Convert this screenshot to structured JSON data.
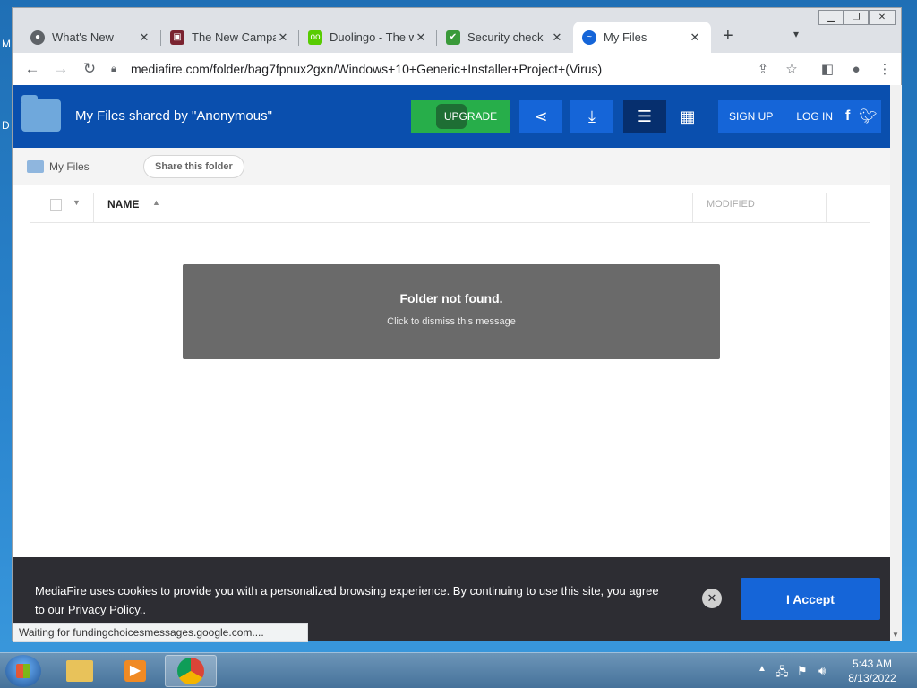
{
  "desktop": {
    "edge_letters": [
      "M",
      "D"
    ]
  },
  "tabs": [
    {
      "label": "What's New",
      "icon": "chrome-icon"
    },
    {
      "label": "The New Campa",
      "icon": "campaign-icon"
    },
    {
      "label": "Duolingo - The w",
      "icon": "duolingo-icon"
    },
    {
      "label": "Security check",
      "icon": "security-check-icon"
    },
    {
      "label": "My Files",
      "icon": "mediafire-icon",
      "active": true
    }
  ],
  "address_bar": {
    "url": "mediafire.com/folder/bag7fpnux2gxn/Windows+10+Generic+Installer+Project+(Virus)"
  },
  "header": {
    "title": "My Files  shared by \"Anonymous\"",
    "upgrade_label": "UPGRADE",
    "sign_up_label": "SIGN UP",
    "log_in_label": "LOG IN"
  },
  "breadcrumb": {
    "label": "My Files",
    "share_label": "Share this folder"
  },
  "file_list": {
    "columns": [
      "NAME",
      "MODIFIED"
    ]
  },
  "notice": {
    "title": "Folder not found.",
    "subtitle": "Click to dismiss this message"
  },
  "cookie_banner": {
    "text": "MediaFire uses cookies to provide you with a personalized browsing experience. By continuing to use this site, you agree to our Privacy Policy..",
    "accept_label": "I Accept"
  },
  "status_bar": {
    "text": "Waiting for fundingchoicesmessages.google.com...."
  },
  "taskbar": {
    "time": "5:43 AM",
    "date": "8/13/2022"
  },
  "colors": {
    "mediafire_blue": "#0a4fae",
    "button_blue": "#1565d8",
    "upgrade_green": "#27ae4a",
    "banner_bg": "#2d2d33"
  }
}
